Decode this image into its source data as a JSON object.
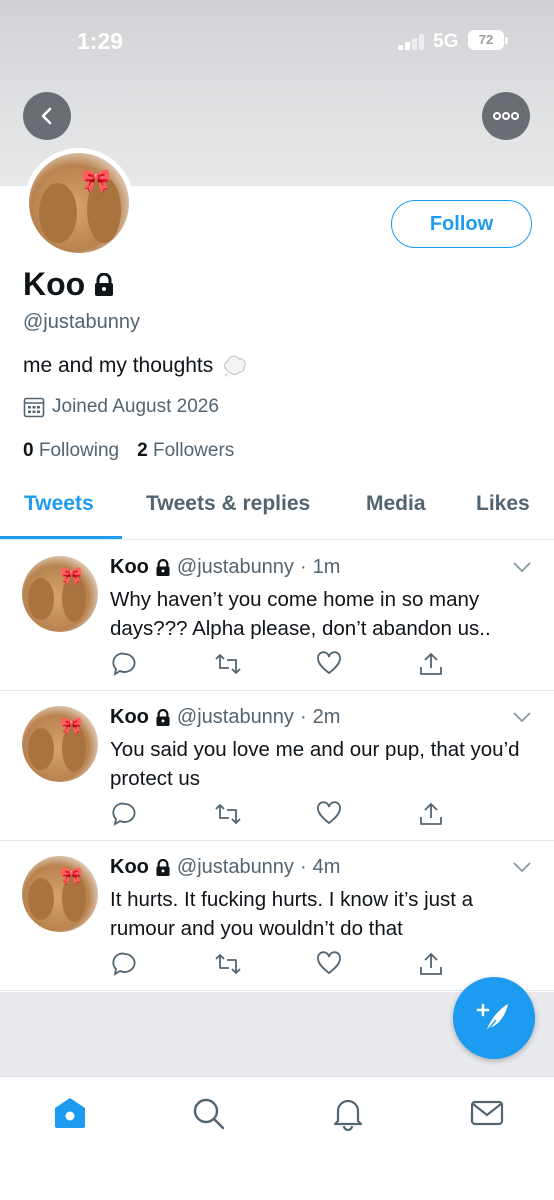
{
  "status_bar": {
    "time": "1:29",
    "network": "5G",
    "battery": "72"
  },
  "profile": {
    "name": "Koo",
    "handle": "@justabunny",
    "bio": "me and my thoughts",
    "joined": "Joined August 2026",
    "following_count": "0",
    "following_label": "Following",
    "followers_count": "2",
    "followers_label": "Followers",
    "follow_label": "Follow"
  },
  "tabs": [
    {
      "label": "Tweets",
      "active": true
    },
    {
      "label": "Tweets & replies",
      "active": false
    },
    {
      "label": "Media",
      "active": false
    },
    {
      "label": "Likes",
      "active": false
    }
  ],
  "tweets": [
    {
      "name": "Koo",
      "handle": "@justabunny",
      "sep": "·",
      "time": "1m",
      "text": "Why haven’t you come home in so many days??? Alpha please, don’t abandon us.."
    },
    {
      "name": "Koo",
      "handle": "@justabunny",
      "sep": "·",
      "time": "2m",
      "text": "You said you love me and our pup, that you’d protect us"
    },
    {
      "name": "Koo",
      "handle": "@justabunny",
      "sep": "·",
      "time": "4m",
      "text": "It hurts. It fucking hurts. I know it’s just a rumour and you wouldn’t do that"
    }
  ],
  "colors": {
    "accent": "#1d9bf0",
    "secondary_text": "#536471"
  },
  "icons": {
    "header": [
      "back-icon",
      "more-icon"
    ],
    "tweet_actions": [
      "reply-icon",
      "retweet-icon",
      "like-icon",
      "share-icon"
    ],
    "tabbar": [
      "home-icon",
      "search-icon",
      "notifications-icon",
      "messages-icon"
    ],
    "fab": "compose-icon"
  }
}
